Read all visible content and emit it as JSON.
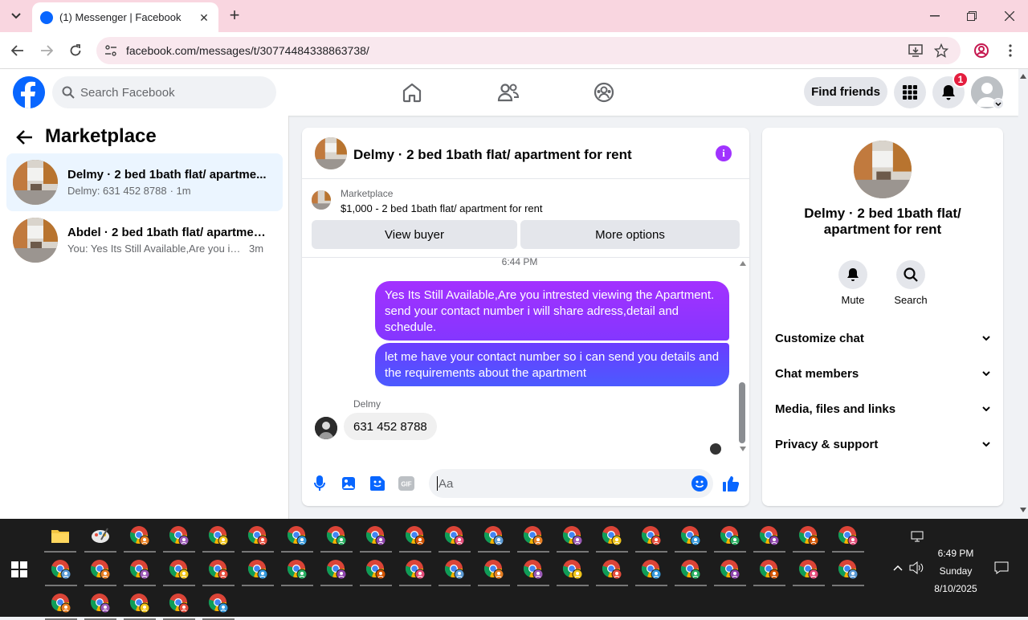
{
  "browser": {
    "tab_title": "(1) Messenger | Facebook",
    "url": "facebook.com/messages/t/30774484338863738/"
  },
  "header": {
    "search_placeholder": "Search Facebook",
    "find_friends": "Find friends",
    "notification_count": "1"
  },
  "left": {
    "title": "Marketplace",
    "conversations": [
      {
        "name": "Delmy · 2 bed 1bath flat/ apartme...",
        "snippet": "Delmy: 631 452 8788",
        "time": "· 1m"
      },
      {
        "name": "Abdel · 2 bed 1bath flat/ apartmen...",
        "snippet": "You: Yes Its Still Available,Are you intr...",
        "time": "3m"
      }
    ]
  },
  "chat": {
    "title": "Delmy · 2 bed 1bath flat/ apartment for rent",
    "marketplace_label": "Marketplace",
    "listing": "$1,000 - 2 bed 1bath flat/ apartment for rent",
    "view_buyer": "View buyer",
    "more_options": "More options",
    "timestamp": "6:44 PM",
    "messages_out": [
      "Yes Its Still Available,Are you intrested viewing the Apartment. send your contact number i will share adress,detail and schedule.",
      "let me have your contact number so i can send you details and the requirements about the apartment"
    ],
    "sender": "Delmy",
    "message_in": "631 452 8788",
    "composer_placeholder": "Aa"
  },
  "right": {
    "name": "Delmy · 2 bed 1bath flat/ apartment for rent",
    "mute": "Mute",
    "search": "Search",
    "rows": [
      "Customize chat",
      "Chat members",
      "Media, files and links",
      "Privacy & support"
    ]
  },
  "taskbar": {
    "time": "6:49 PM",
    "day": "Sunday",
    "date": "8/10/2025"
  },
  "colors": {
    "fb_blue": "#0866ff",
    "messenger_purple": "#a033ff",
    "bubble_blue": "#4b57ff"
  }
}
